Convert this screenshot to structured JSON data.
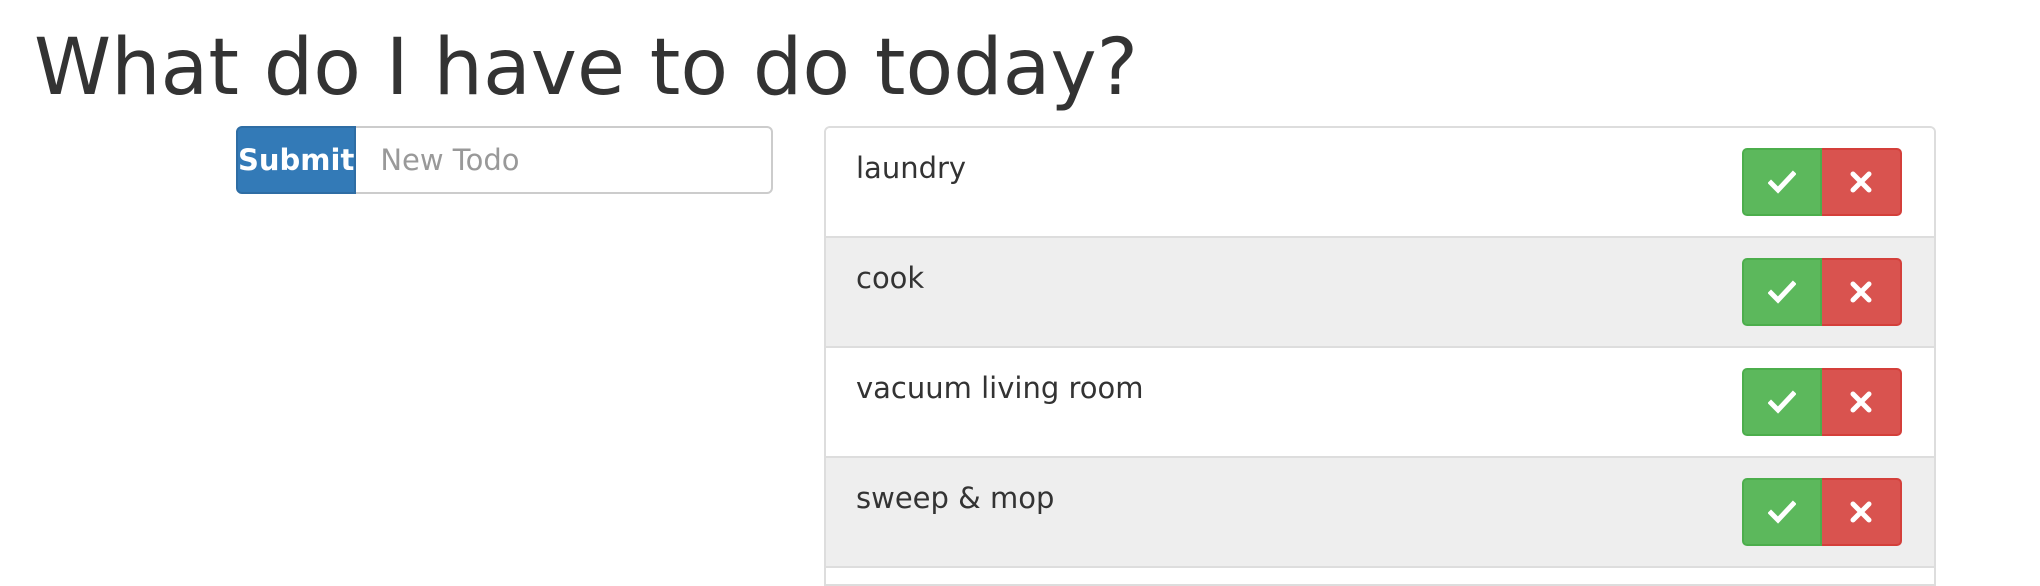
{
  "page": {
    "title": "What do I have to do today?"
  },
  "form": {
    "submit_label": "Submit",
    "input_placeholder": "New Todo",
    "input_value": ""
  },
  "todos": [
    {
      "text": "laundry"
    },
    {
      "text": "cook"
    },
    {
      "text": "vacuum living room"
    },
    {
      "text": "sweep & mop"
    }
  ],
  "icons": {
    "done": "check-icon",
    "delete": "close-icon"
  },
  "colors": {
    "primary": "#337ab7",
    "success": "#5cb85c",
    "danger": "#d9534f",
    "row_alt": "#eeeeee",
    "text": "#333333"
  }
}
